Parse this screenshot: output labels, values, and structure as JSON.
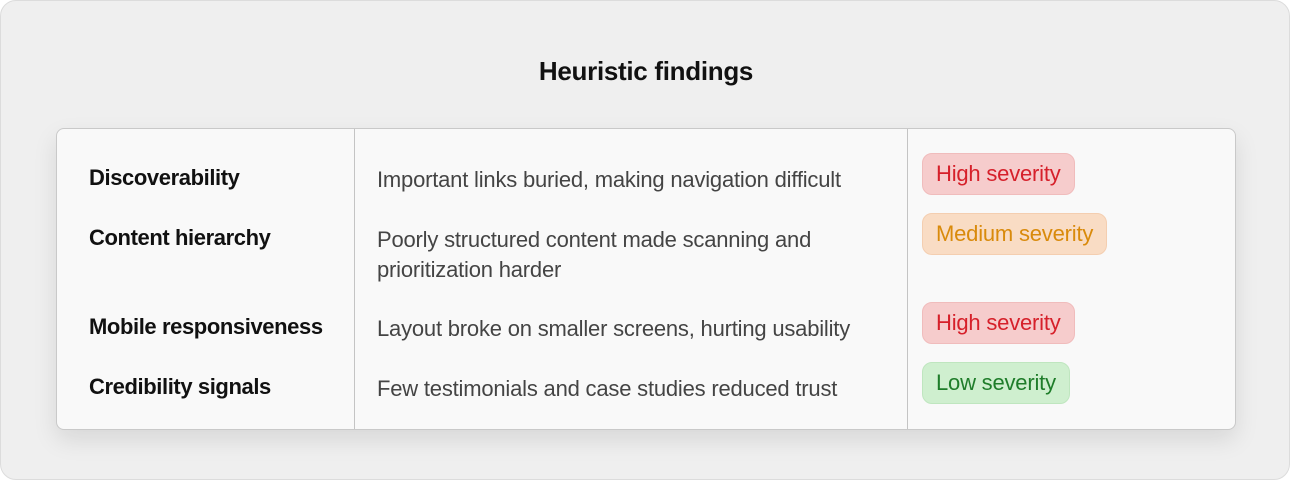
{
  "title": "Heuristic findings",
  "findings": [
    {
      "category": "Discoverability",
      "description": "Important links buried, making navigation difficult",
      "severity": "High severity",
      "severity_level": "high"
    },
    {
      "category": "Content hierarchy",
      "description": "Poorly structured content made scanning and prioritization harder",
      "severity": "Medium severity",
      "severity_level": "medium"
    },
    {
      "category": "Mobile responsiveness",
      "description": "Layout broke on smaller screens, hurting usability",
      "severity": "High severity",
      "severity_level": "high"
    },
    {
      "category": "Credibility signals",
      "description": "Few testimonials and case studies reduced trust",
      "severity": "Low severity",
      "severity_level": "low"
    }
  ],
  "colors": {
    "high_text": "#d6202a",
    "high_bg": "#f6cccc",
    "medium_text": "#d98a0b",
    "medium_bg": "#f9dcc4",
    "low_text": "#1f7d2a",
    "low_bg": "#cfefcf"
  }
}
